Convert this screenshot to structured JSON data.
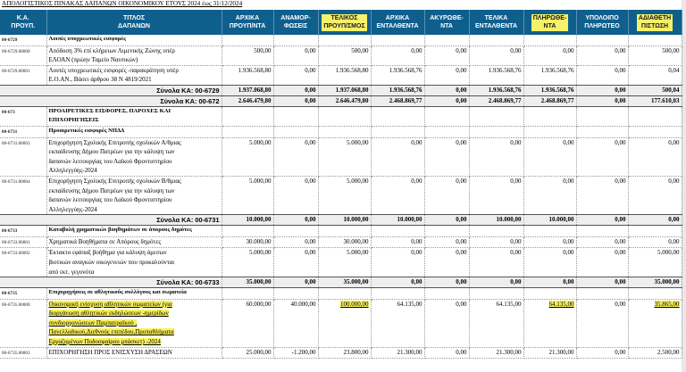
{
  "document": {
    "title": "ΑΠΟΛΟΓΙΣΤΙΚΟΣ ΠΙΝΑΚΑΣ ΔΑΠΑΝΩΝ ΟΙΚΟΝΟΜΙΚΟΥ ΕΤΟΥΣ 2024 έως 31/12/2024"
  },
  "highlight_color": "#f6f16a",
  "header_color": "#0f5f8d",
  "columns": [
    {
      "line1": "Κ.Α.",
      "line2": "ΠΡΟΥΠ.",
      "highlighted": false
    },
    {
      "line1": "ΤΙΤΛΟΣ",
      "line2": "ΔΑΠΑΝΩΝ",
      "highlighted": false
    },
    {
      "line1": "ΑΡΧΙΚΑ",
      "line2": "ΠΡΟΥΠ/ΝΤΑ",
      "highlighted": false
    },
    {
      "line1": "ΑΝΑΜΟΡ-",
      "line2": "ΦΩΣΕΙΣ",
      "highlighted": false
    },
    {
      "line1": "ΤΕΛΙΚΟΣ",
      "line2": "ΠΡΟΥΠ/ΣΜΟΣ",
      "highlighted": true
    },
    {
      "line1": "ΑΡΧΙΚΑ",
      "line2": "ΕΝΤΑΛΘΕΝΤΑ",
      "highlighted": false
    },
    {
      "line1": "ΑΚΥΡΩΘΕ-",
      "line2": "ΝΤΑ",
      "highlighted": false
    },
    {
      "line1": "ΤΕΛΙΚΑ",
      "line2": "ΕΝΤΑΛΘΕΝΤΑ",
      "highlighted": false
    },
    {
      "line1": "ΠΛΗΡΩΘΕ-",
      "line2": "ΝΤΑ",
      "highlighted": true
    },
    {
      "line1": "ΥΠΟΛΟΙΠΟ",
      "line2": "ΠΛΗΡΩΤΕΟ",
      "highlighted": false
    },
    {
      "line1": "ΑΔΙΑΘΕΤΗ",
      "line2": "ΠΙΣΤΩΣΗ",
      "highlighted": true
    }
  ],
  "rows": [
    {
      "type": "hdr",
      "code": "00-6729",
      "desc": "Λοιπές υποχρεωτικές εισφορές"
    },
    {
      "type": "item",
      "code": "00-6729.00000",
      "desc_lines": [
        "Απόδοση 3% επί κλήρειων Λιμενικής Ζώνης υπέρ",
        "ΕΛΟΑΝ (πρώην Ταμείο Ναυτικών)"
      ],
      "values": [
        "500,00",
        "0,00",
        "500,00",
        "0,00",
        "0,00",
        "0,00",
        "0,00",
        "0,00",
        "500,00"
      ]
    },
    {
      "type": "item",
      "code": "00-6729.00001",
      "desc_lines": [
        "Λοιπές υποχρεωτικές εισφορές -παρακράτηση υπέρ",
        "Ε.Ο.ΑΝ., Βάσει άρθρου 38 Ν 4819/2021"
      ],
      "values": [
        "1.936.568,80",
        "0,00",
        "1.936.568,80",
        "1.936.568,76",
        "0,00",
        "1.936.568,76",
        "1.936.568,76",
        "0,00",
        "0,04"
      ]
    },
    {
      "type": "sum",
      "label": "Σύνολα ΚΑ: 00-6729",
      "values": [
        "1.937.068,80",
        "0,00",
        "1.937.068,80",
        "1.936.568,76",
        "0,00",
        "1.936.568,76",
        "1.936.568,76",
        "0,00",
        "500,04"
      ]
    },
    {
      "type": "sum",
      "label": "Σύνολα ΚΑ: 00-672",
      "values": [
        "2.646.479,80",
        "0,00",
        "2.646.479,80",
        "2.468.869,77",
        "0,00",
        "2.468.869,77",
        "2.468.869,77",
        "0,00",
        "177.610,03"
      ]
    },
    {
      "type": "hdr",
      "code": "00-673",
      "desc": "ΠΡΟΑΙΡΕΤΙΚΕΣ ΕΙΣΦΟΡΕΣ, ΠΑΡΟΧΕΣ ΚΑΙ ΕΠΙΧΟΡΗΓΗΣΕΙΣ"
    },
    {
      "type": "hdr",
      "code": "00-6731",
      "desc": "Προαιρετικές εισφορές ΝΠΔΔ"
    },
    {
      "type": "item",
      "code": "00-6731.00003",
      "desc_lines": [
        "Επιχορήγηση Σχολικής Επιτροπής σχολικών Α/θμιας",
        "εκπαίδευσης Δήμου Πατρέων για την κάλυψη των",
        "δαπανών λειτουργίας του Λαϊκού Φροντιστηρίου",
        "Αλληλεγγύης-2024"
      ],
      "values": [
        "5.000,00",
        "0,00",
        "5.000,00",
        "0,00",
        "0,00",
        "0,00",
        "0,00",
        "0,00",
        "0,00"
      ]
    },
    {
      "type": "item",
      "code": "00-6731.00004",
      "desc_lines": [
        "Επιχορήγηση Σχολικής Επιτροπής σχολικών Β/θμιας",
        "εκπαίδευσης Δήμου Πατρέων για την κάλυψη των",
        "δαπανών λειτουργίας του Λαϊκού Φροντιστηρίου",
        "Αλληλεγγύης-2024"
      ],
      "values": [
        "5.000,00",
        "0,00",
        "5.000,00",
        "0,00",
        "0,00",
        "0,00",
        "0,00",
        "0,00",
        "0,00"
      ]
    },
    {
      "type": "sum",
      "label": "Σύνολα ΚΑ: 00-6731",
      "values": [
        "10.000,00",
        "0,00",
        "10.000,00",
        "10.000,00",
        "0,00",
        "10.000,00",
        "10.000,00",
        "0,00",
        "0,00"
      ]
    },
    {
      "type": "hdr",
      "code": "00-6733",
      "desc": "Καταβολή χρηματικών βοηθημάτων σε άπορους δημότες"
    },
    {
      "type": "item",
      "code": "00-6733.00001",
      "desc_lines": [
        "Χρηματικά Βοηθήματα σε Απόρους δημότες"
      ],
      "values": [
        "30.000,00",
        "0,00",
        "30.000,00",
        "0,00",
        "0,00",
        "0,00",
        "0,00",
        "0,00",
        "0,00"
      ]
    },
    {
      "type": "item",
      "code": "00-6733.00002",
      "desc_lines": [
        "Έκτακτο εφάπαξ βοήθημα για κάλυψη άμεσων",
        "βιοτικών αναγκών οικογενειών που προκαλούνται",
        "από εκτ. γεγονότα"
      ],
      "values": [
        "5.000,00",
        "0,00",
        "5.000,00",
        "0,00",
        "0,00",
        "0,00",
        "0,00",
        "0,00",
        "5.000,00"
      ]
    },
    {
      "type": "sum",
      "label": "Σύνολα ΚΑ: 00-6733",
      "values": [
        "35.000,00",
        "0,00",
        "35.000,00",
        "0,00",
        "0,00",
        "0,00",
        "0,00",
        "0,00",
        "35.000,00"
      ]
    },
    {
      "type": "hdr",
      "code": "00-6735",
      "desc": "Επιχορηγήσεις σε αθλητικούς συλλόγους και σωματεία"
    },
    {
      "type": "item",
      "code": "00-6735.00000",
      "highlight": true,
      "desc_lines": [
        "Οικονομική ενίσχυση αθλητικών σωματείων (για",
        "διοργάνωση αθλητικών εκδηλώσεων -ημερίδων",
        "συνδιοργανώσεων Παμπατραϊκού ,",
        "Πανελλαδικού,Διεθνούς επιπέδου,Προπαθλήματα",
        "Εργαζομένων Ποδοσφαίρου μπάσκετ) -2024"
      ],
      "values": [
        "60.000,00",
        "40.000,00",
        "100.000,00",
        "64.135,00",
        "0,00",
        "64.135,00",
        "64.135,00",
        "0,00",
        "35.865,00"
      ]
    },
    {
      "type": "item",
      "code": "00-6735.00001",
      "desc_lines": [
        "ΕΠΙΧΟΡΗΓΗΣΗ ΠΡΟΣ ΕΝΙΣΧΥΣΗ ΔΡΑΣΕΩΝ"
      ],
      "values": [
        "25.000,00",
        "-1.200,00",
        "23.800,00",
        "21.300,00",
        "0,00",
        "21.300,00",
        "21.300,00",
        "0,00",
        "2.500,00"
      ]
    }
  ]
}
